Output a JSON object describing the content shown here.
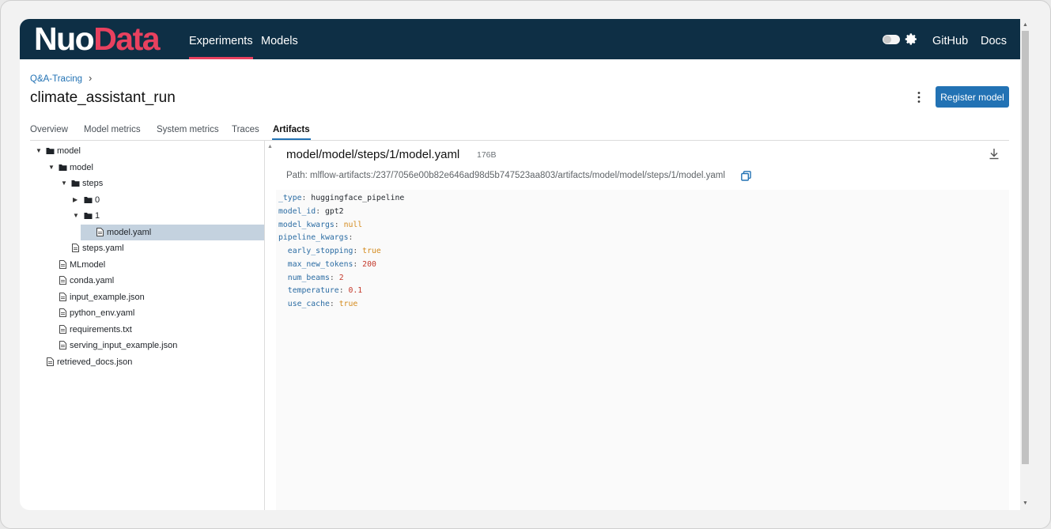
{
  "nav": {
    "logo_part1": "Nuo",
    "logo_part2": "Data",
    "links": [
      "Experiments",
      "Models"
    ],
    "active_link": "Experiments",
    "right_links": [
      "GitHub",
      "Docs"
    ]
  },
  "breadcrumb": {
    "item": "Q&A-Tracing",
    "separator": "›"
  },
  "page_title": "climate_assistant_run",
  "actions": {
    "register_label": "Register model"
  },
  "tabs": [
    "Overview",
    "Model metrics",
    "System metrics",
    "Traces",
    "Artifacts"
  ],
  "active_tab": "Artifacts",
  "tree": [
    {
      "label": "model",
      "type": "folder",
      "expanded": true,
      "selected": false
    },
    {
      "label": "model",
      "type": "folder",
      "expanded": true,
      "selected": false
    },
    {
      "label": "steps",
      "type": "folder",
      "expanded": true,
      "selected": false
    },
    {
      "label": "0",
      "type": "folder",
      "expanded": false,
      "selected": false
    },
    {
      "label": "1",
      "type": "folder",
      "expanded": true,
      "selected": false
    },
    {
      "label": "model.yaml",
      "type": "file",
      "selected": true
    },
    {
      "label": "steps.yaml",
      "type": "file",
      "selected": false
    },
    {
      "label": "MLmodel",
      "type": "file",
      "selected": false
    },
    {
      "label": "conda.yaml",
      "type": "file",
      "selected": false
    },
    {
      "label": "input_example.json",
      "type": "file",
      "selected": false
    },
    {
      "label": "python_env.yaml",
      "type": "file",
      "selected": false
    },
    {
      "label": "requirements.txt",
      "type": "file",
      "selected": false
    },
    {
      "label": "serving_input_example.json",
      "type": "file",
      "selected": false
    },
    {
      "label": "retrieved_docs.json",
      "type": "file",
      "selected": false
    }
  ],
  "viewer": {
    "file_path": "model/model/steps/1/model.yaml",
    "file_size": "176B",
    "path_line": "Path: mlflow-artifacts:/237/7056e00b82e646ad98d5b747523aa803/artifacts/model/model/steps/1/model.yaml"
  },
  "code_lines": [
    {
      "indent": "",
      "key": "_type",
      "value": "huggingface_pipeline",
      "vtype": "s"
    },
    {
      "indent": "",
      "key": "model_id",
      "value": "gpt2",
      "vtype": "s"
    },
    {
      "indent": "",
      "key": "model_kwargs",
      "value": "null",
      "vtype": "b"
    },
    {
      "indent": "",
      "key": "pipeline_kwargs",
      "value": "",
      "vtype": "s"
    },
    {
      "indent": "  ",
      "key": "early_stopping",
      "value": "true",
      "vtype": "b"
    },
    {
      "indent": "  ",
      "key": "max_new_tokens",
      "value": "200",
      "vtype": "n"
    },
    {
      "indent": "  ",
      "key": "num_beams",
      "value": "2",
      "vtype": "n"
    },
    {
      "indent": "  ",
      "key": "temperature",
      "value": "0.1",
      "vtype": "n"
    },
    {
      "indent": "  ",
      "key": "use_cache",
      "value": "true",
      "vtype": "b"
    }
  ],
  "colors": {
    "header_bg": "#0e2f45",
    "accent": "#e8415f",
    "primary": "#2272b4",
    "selected_row": "#c4d2df"
  },
  "icons": [
    "gear-icon",
    "theme-toggle",
    "kebab-menu-icon",
    "download-icon",
    "copy-icon",
    "folder-icon",
    "file-icon",
    "caret-down-icon",
    "caret-right-icon"
  ]
}
